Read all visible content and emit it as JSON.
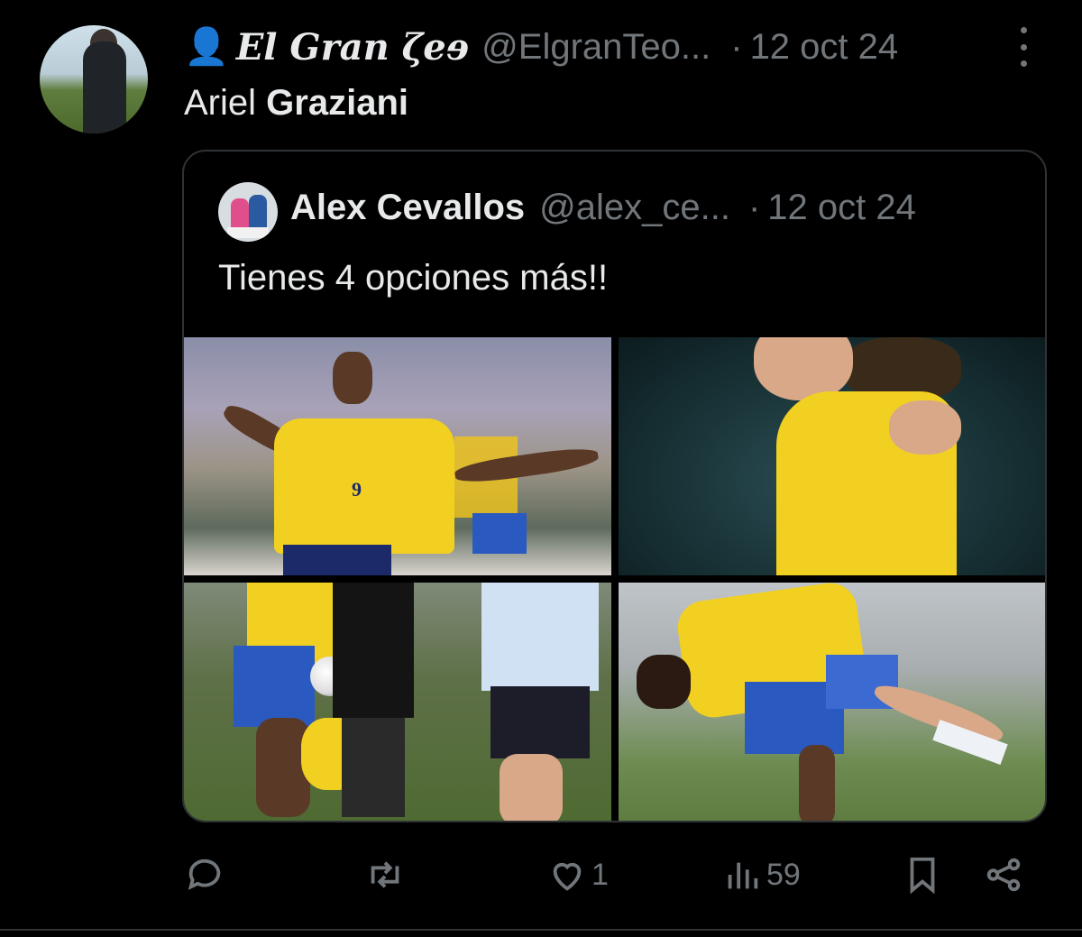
{
  "tweet": {
    "author": {
      "emoji": "👤",
      "display_name": "El Gran ζeɘ",
      "handle": "@ElgranTeo...",
      "separator": "·",
      "date": "12 oct 24"
    },
    "text_plain": "Ariel",
    "text_bold": "Graziani",
    "quoted": {
      "display_name": "Alex Cevallos",
      "handle": "@alex_ce...",
      "separator": "·",
      "date": "12 oct 24",
      "text": "Tienes 4 opciones más!!",
      "photos": [
        {
          "jersey_number": "9"
        },
        {
          "jersey_number": ""
        },
        {
          "jersey_number": ""
        },
        {
          "jersey_number": ""
        }
      ]
    },
    "actions": {
      "reply_count": "",
      "retweet_count": "",
      "like_count": "1",
      "views_count": "59"
    }
  },
  "colors": {
    "background": "#000000",
    "text_primary": "#e7e9ea",
    "text_secondary": "#71767b",
    "border": "#2f3336",
    "person_emoji": "#5d8fd6"
  },
  "icons": [
    "more-icon",
    "reply-icon",
    "retweet-icon",
    "like-icon",
    "views-icon",
    "bookmark-icon",
    "share-icon"
  ]
}
